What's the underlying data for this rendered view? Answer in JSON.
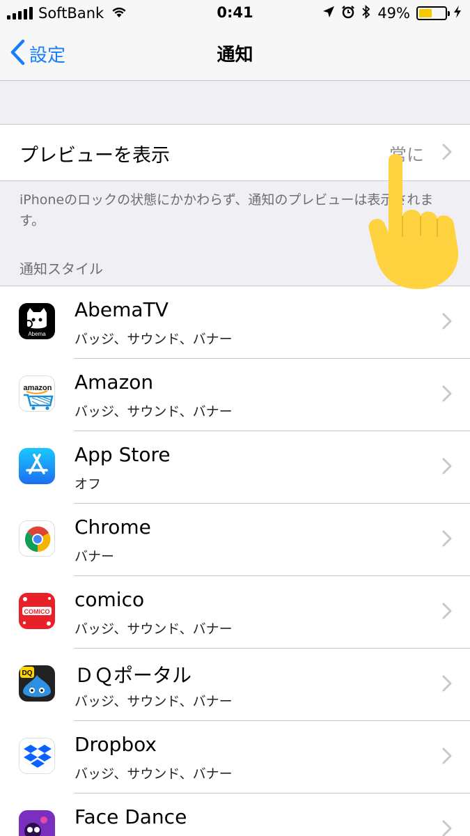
{
  "status_bar": {
    "carrier": "SoftBank",
    "time": "0:41",
    "battery_percent": "49%",
    "battery_level": 0.49,
    "icons": [
      "signal-icon",
      "wifi-icon",
      "location-icon",
      "alarm-icon",
      "bluetooth-icon",
      "battery-icon",
      "charging-icon"
    ]
  },
  "nav": {
    "back_label": "設定",
    "title": "通知"
  },
  "preview": {
    "label": "プレビューを表示",
    "value": "常に",
    "footnote": "iPhoneのロックの状態にかかわらず、通知のプレビューは表示されます。"
  },
  "section": {
    "header": "通知スタイル"
  },
  "apps": [
    {
      "name": "AbemaTV",
      "detail": "バッジ、サウンド、バナー",
      "icon": "abematv-icon"
    },
    {
      "name": "Amazon",
      "detail": "バッジ、サウンド、バナー",
      "icon": "amazon-icon"
    },
    {
      "name": "App Store",
      "detail": "オフ",
      "icon": "app-store-icon"
    },
    {
      "name": "Chrome",
      "detail": "バナー",
      "icon": "chrome-icon"
    },
    {
      "name": "comico",
      "detail": "バッジ、サウンド、バナー",
      "icon": "comico-icon"
    },
    {
      "name": "ＤＱポータル",
      "detail": "バッジ、サウンド、バナー",
      "icon": "dq-portal-icon"
    },
    {
      "name": "Dropbox",
      "detail": "バッジ、サウンド、バナー",
      "icon": "dropbox-icon"
    },
    {
      "name": "Face Dance",
      "detail": "",
      "icon": "face-dance-icon"
    }
  ],
  "icon_texts": {
    "abema": "Abema",
    "amazon": "amazon",
    "comico": "COMICO",
    "dq": "DQ"
  },
  "colors": {
    "accent": "#147efb",
    "background": "#efeff4",
    "secondary_text": "#8e8e93",
    "hand": "#ffd23f"
  }
}
